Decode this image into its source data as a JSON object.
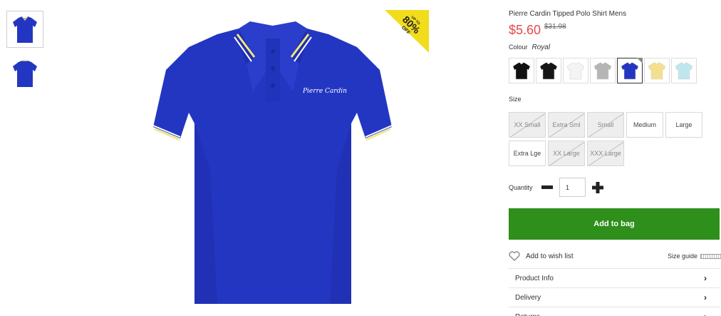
{
  "product": {
    "title": "Pierre Cardin Tipped Polo Shirt Mens",
    "price": "$5.60",
    "old_price": "$31.98",
    "brand_text": "Pierre Cardin",
    "badge": {
      "line1": "UP TO",
      "line2": "80%",
      "line3": "OFF"
    }
  },
  "colour": {
    "label": "Colour",
    "value": "Royal",
    "swatches": [
      {
        "name": "Black",
        "color": "#111111"
      },
      {
        "name": "Black",
        "color": "#151515"
      },
      {
        "name": "White",
        "color": "#f4f4f4"
      },
      {
        "name": "Grey",
        "color": "#b5b5b5"
      },
      {
        "name": "Royal",
        "color": "#2336c2"
      },
      {
        "name": "Yellow",
        "color": "#f3e08f"
      },
      {
        "name": "Sky",
        "color": "#bfe6ee"
      }
    ],
    "selected_index": 4
  },
  "size": {
    "label": "Size",
    "options": [
      {
        "label": "XX Small",
        "available": false
      },
      {
        "label": "Extra Sml",
        "available": false
      },
      {
        "label": "Small",
        "available": false
      },
      {
        "label": "Medium",
        "available": true
      },
      {
        "label": "Large",
        "available": true
      },
      {
        "label": "Extra Lge",
        "available": true
      },
      {
        "label": "XX Large",
        "available": false
      },
      {
        "label": "XXX Large",
        "available": false
      }
    ]
  },
  "quantity": {
    "label": "Quantity",
    "value": "1"
  },
  "add_to_bag": "Add to bag",
  "wishlist": "Add to wish list",
  "size_guide": "Size guide",
  "accordion": [
    {
      "label": "Product Info"
    },
    {
      "label": "Delivery"
    },
    {
      "label": "Returns"
    }
  ],
  "colors": {
    "price": "#e74848",
    "button": "#2e8f1b",
    "shirt": "#2336c2",
    "tipping": "#f2e77a"
  }
}
